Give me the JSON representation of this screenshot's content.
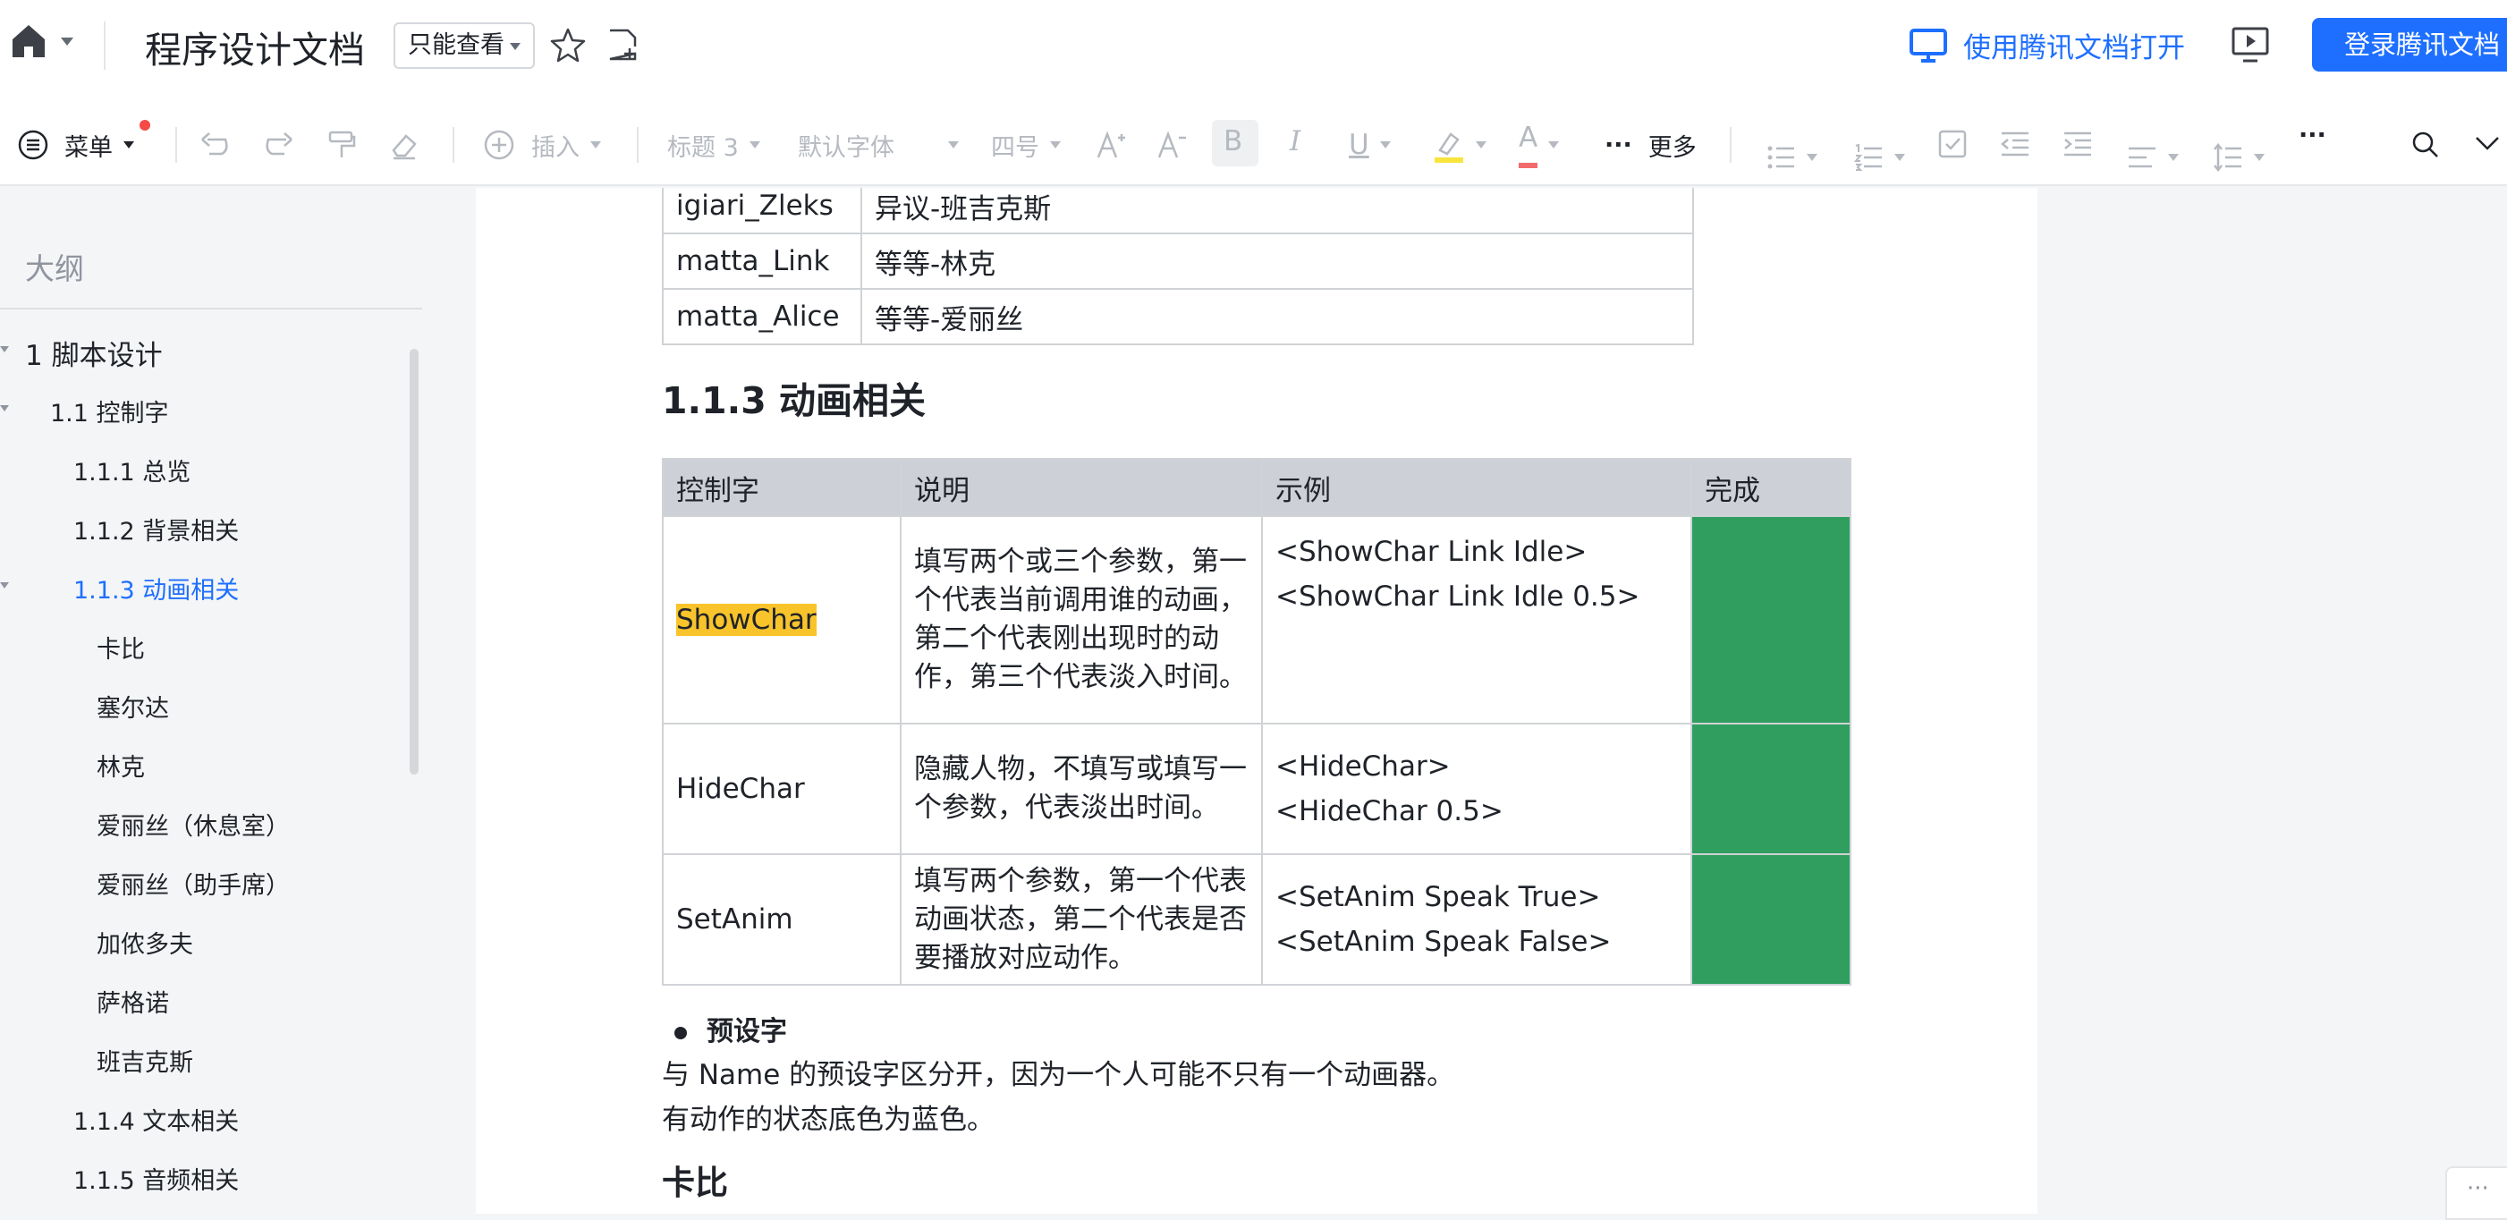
{
  "header": {
    "doc_title": "程序设计文档",
    "mode_label": "只能查看",
    "open_in_app": "使用腾讯文档打开",
    "login_label": "登录腾讯文档"
  },
  "toolbar": {
    "menu": "菜单",
    "insert": "插入",
    "heading": "标题 3",
    "font": "默认字体",
    "size": "四号",
    "bold": "B",
    "italic": "I",
    "underline": "U",
    "font_color": "A",
    "more": "更多",
    "more_dots": "···",
    "overflow_dots": "···"
  },
  "sidebar": {
    "title": "大纲",
    "items": [
      {
        "label": "1  脚本设计"
      },
      {
        "label": "1.1  控制字"
      },
      {
        "label": "1.1.1  总览"
      },
      {
        "label": "1.1.2  背景相关"
      },
      {
        "label": "1.1.3  动画相关"
      },
      {
        "label": "卡比"
      },
      {
        "label": "塞尔达"
      },
      {
        "label": "林克"
      },
      {
        "label": "爱丽丝（休息室）"
      },
      {
        "label": "爱丽丝（助手席）"
      },
      {
        "label": "加侬多夫"
      },
      {
        "label": "萨格诺"
      },
      {
        "label": "班吉克斯"
      },
      {
        "label": "1.1.4  文本相关"
      },
      {
        "label": "1.1.5  音频相关"
      }
    ]
  },
  "doc": {
    "prev_table": [
      [
        "igiari_Zleks",
        "异议-班吉克斯"
      ],
      [
        "matta_Link",
        "等等-林克"
      ],
      [
        "matta_Alice",
        "等等-爱丽丝"
      ]
    ],
    "section_heading": "1.1.3 动画相关",
    "table_headers": [
      "控制字",
      "说明",
      "示例",
      "完成"
    ],
    "table_rows": [
      {
        "key": "ShowChar",
        "desc": "填写两个或三个参数，第一个代表当前调用谁的动画，第二个代表刚出现时的动作，第三个代表淡入时间。",
        "ex1": "<ShowChar Link Idle>",
        "ex2": "<ShowChar Link Idle 0.5>"
      },
      {
        "key": "HideChar",
        "desc": "隐藏人物，不填写或填写一个参数，代表淡出时间。",
        "ex1": "<HideChar>",
        "ex2": "<HideChar 0.5>"
      },
      {
        "key": "SetAnim",
        "desc": "填写两个参数，第一个代表动画状态，第二个代表是否要播放对应动作。",
        "ex1": "<SetAnim Speak True>",
        "ex2": "<SetAnim Speak False>"
      }
    ],
    "bullet": "预设字",
    "para1": "与 Name 的预设字区分开，因为一个人可能不只有一个动画器。",
    "para2": "有动作的状态底色为蓝色。",
    "next_heading": "卡比"
  },
  "colors": {
    "accent": "#1e6fff",
    "done_green": "#2f9e5f",
    "highlight": "#f9c42b",
    "header_gray": "#cdd0d7"
  }
}
